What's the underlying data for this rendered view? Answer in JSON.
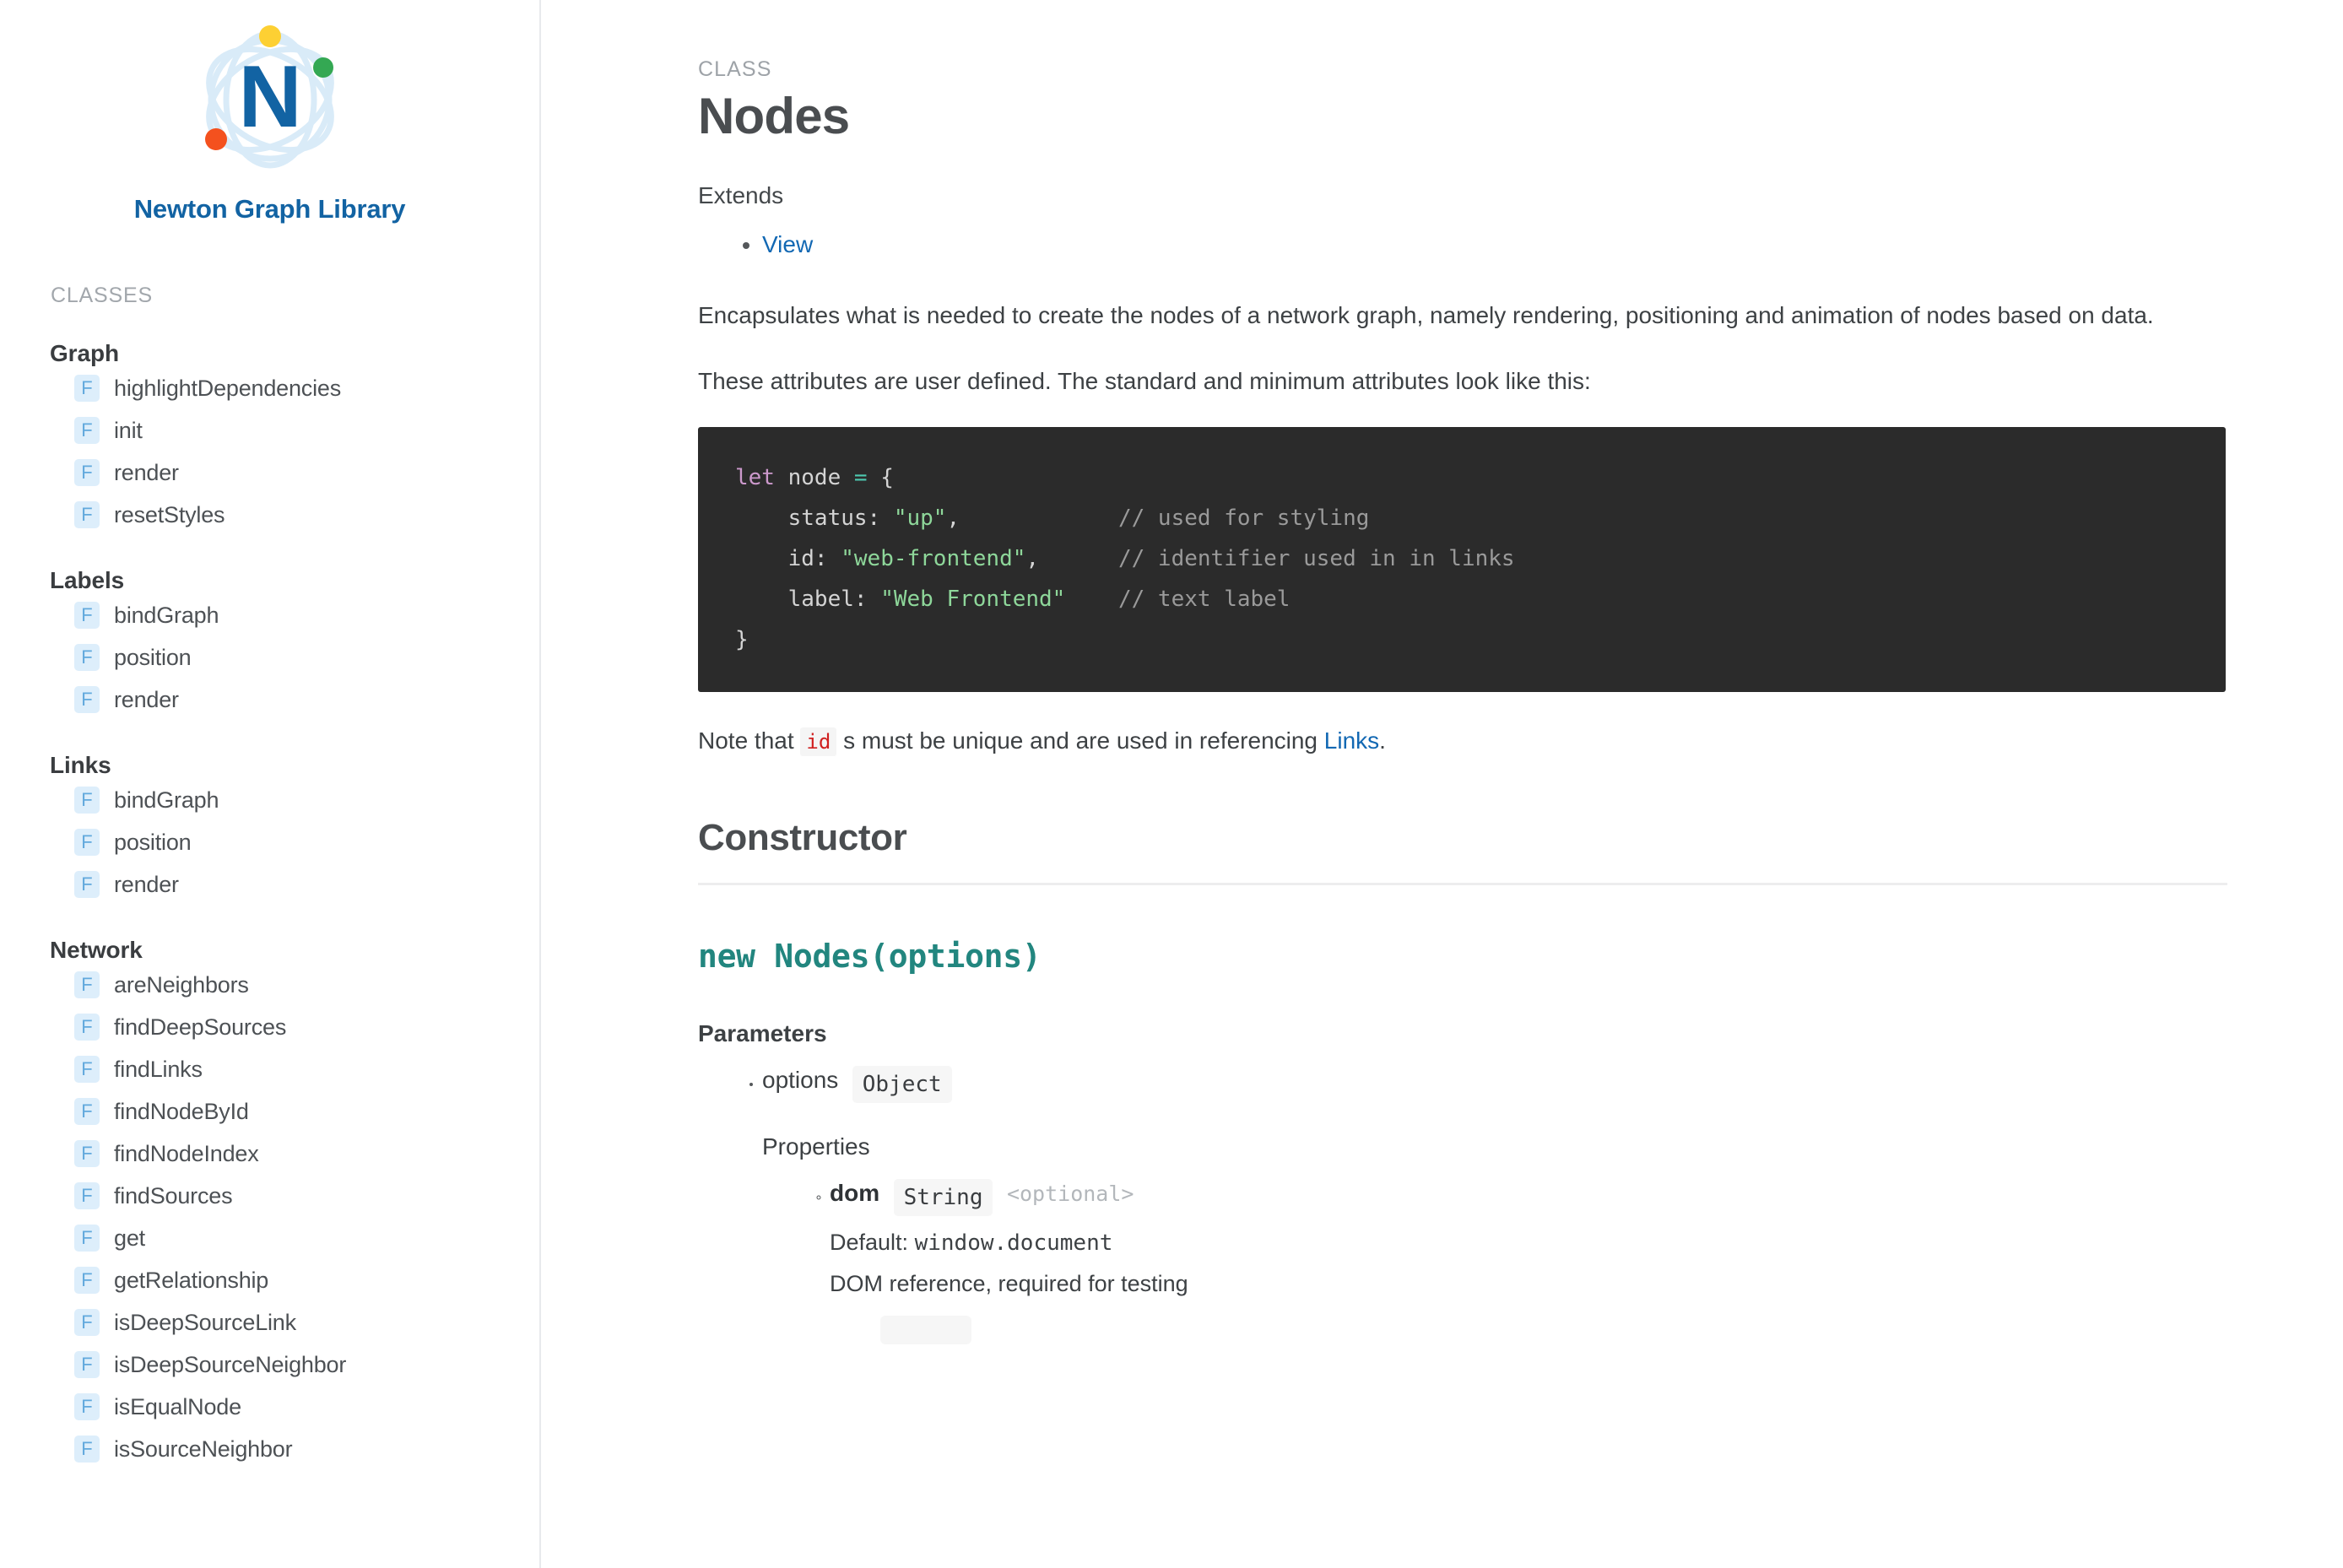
{
  "sidebar": {
    "brand_name": "Newton Graph Library",
    "logo_icon": "atom-logo-icon",
    "logo_letter": "N",
    "logo_colors": {
      "letter": "#1263a3",
      "orbit": "#d6eaf7",
      "dot_top": "#fdd033",
      "dot_right": "#34a853",
      "dot_left": "#f4511e"
    },
    "section_label": "CLASSES",
    "groups": [
      {
        "title": "Graph",
        "items": [
          {
            "badge": "F",
            "label": "highlightDependencies"
          },
          {
            "badge": "F",
            "label": "init"
          },
          {
            "badge": "F",
            "label": "render"
          },
          {
            "badge": "F",
            "label": "resetStyles"
          }
        ]
      },
      {
        "title": "Labels",
        "items": [
          {
            "badge": "F",
            "label": "bindGraph"
          },
          {
            "badge": "F",
            "label": "position"
          },
          {
            "badge": "F",
            "label": "render"
          }
        ]
      },
      {
        "title": "Links",
        "items": [
          {
            "badge": "F",
            "label": "bindGraph"
          },
          {
            "badge": "F",
            "label": "position"
          },
          {
            "badge": "F",
            "label": "render"
          }
        ]
      },
      {
        "title": "Network",
        "items": [
          {
            "badge": "F",
            "label": "areNeighbors"
          },
          {
            "badge": "F",
            "label": "findDeepSources"
          },
          {
            "badge": "F",
            "label": "findLinks"
          },
          {
            "badge": "F",
            "label": "findNodeById"
          },
          {
            "badge": "F",
            "label": "findNodeIndex"
          },
          {
            "badge": "F",
            "label": "findSources"
          },
          {
            "badge": "F",
            "label": "get"
          },
          {
            "badge": "F",
            "label": "getRelationship"
          },
          {
            "badge": "F",
            "label": "isDeepSourceLink"
          },
          {
            "badge": "F",
            "label": "isDeepSourceNeighbor"
          },
          {
            "badge": "F",
            "label": "isEqualNode"
          },
          {
            "badge": "F",
            "label": "isSourceNeighbor"
          }
        ]
      }
    ]
  },
  "main": {
    "kicker": "CLASS",
    "title": "Nodes",
    "extends_label": "Extends",
    "extends_items": [
      "View"
    ],
    "description": "Encapsulates what is needed to create the nodes of a network graph, namely rendering, positioning and animation of nodes based on data.",
    "attributes_intro": "These attributes are user defined. The standard and minimum attributes look like this:",
    "code_sample": {
      "lines": [
        [
          {
            "t": "kw",
            "v": "let"
          },
          {
            "t": "pln",
            "v": " node "
          },
          {
            "t": "op",
            "v": "="
          },
          {
            "t": "pln",
            "v": " {"
          }
        ],
        [
          {
            "t": "pln",
            "v": "    status: "
          },
          {
            "t": "str",
            "v": "\"up\""
          },
          {
            "t": "pln",
            "v": ","
          },
          {
            "t": "pln",
            "v": "            "
          },
          {
            "t": "com",
            "v": "// used for styling"
          }
        ],
        [
          {
            "t": "pln",
            "v": "    id: "
          },
          {
            "t": "str",
            "v": "\"web-frontend\""
          },
          {
            "t": "pln",
            "v": ","
          },
          {
            "t": "pln",
            "v": "      "
          },
          {
            "t": "com",
            "v": "// identifier used in in links"
          }
        ],
        [
          {
            "t": "pln",
            "v": "    label: "
          },
          {
            "t": "str",
            "v": "\"Web Frontend\""
          },
          {
            "t": "pln",
            "v": "    "
          },
          {
            "t": "com",
            "v": "// text label"
          }
        ],
        [
          {
            "t": "pln",
            "v": "}"
          }
        ]
      ]
    },
    "note": {
      "before": "Note that ",
      "code": "id",
      "middle": " s must be unique and are used in referencing ",
      "link": "Links",
      "after": "."
    },
    "constructor_heading": "Constructor",
    "signature": "new Nodes(options)",
    "parameters_title": "Parameters",
    "parameters": [
      {
        "name": "options",
        "type": "Object",
        "properties_title": "Properties",
        "properties": [
          {
            "name": "dom",
            "type": "String",
            "optional_tag": "<optional>",
            "default_label": "Default:",
            "default_value": "window.document",
            "description": "DOM reference, required for testing"
          }
        ]
      }
    ]
  },
  "theme": {
    "link_color": "#1268b3",
    "brand_color": "#1263a3",
    "signature_color": "#22867f",
    "code_bg": "#2b2b2b",
    "inline_code_color": "#d02020",
    "badge_bg": "#ddeefb",
    "badge_fg": "#62a9dd"
  }
}
